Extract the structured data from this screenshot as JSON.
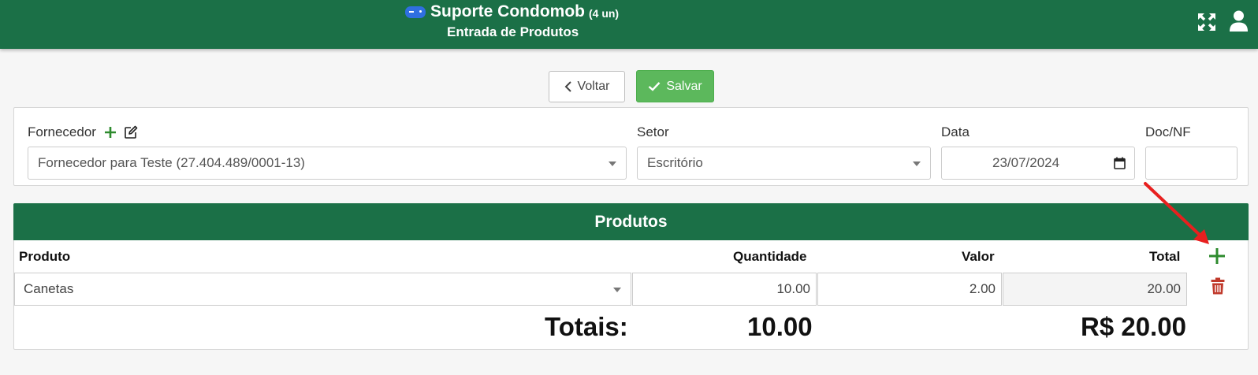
{
  "header": {
    "app_title": "Suporte Condomob",
    "units": "(4 un)",
    "subtitle": "Entrada de Produtos",
    "icons": [
      "gamepad-icon",
      "expand-icon",
      "user-icon"
    ]
  },
  "toolbar": {
    "back_label": "Voltar",
    "save_label": "Salvar"
  },
  "form": {
    "supplier_label": "Fornecedor",
    "supplier_value": "Fornecedor para Teste (27.404.489/0001-13)",
    "sector_label": "Setor",
    "sector_value": "Escritório",
    "date_label": "Data",
    "date_value": "23/07/2024",
    "doc_label": "Doc/NF",
    "doc_value": ""
  },
  "products": {
    "title": "Produtos",
    "columns": [
      "Produto",
      "Quantidade",
      "Valor",
      "Total"
    ],
    "rows": [
      {
        "product": "Canetas",
        "quantity": "10.00",
        "value": "2.00",
        "total": "20.00"
      }
    ],
    "totals_label": "Totais:",
    "totals_quantity": "10.00",
    "totals_value": "R$ 20.00"
  },
  "colors": {
    "header_green": "#1b7047",
    "save_green": "#5cb85c",
    "add_green": "#2e8b2e",
    "delete_red": "#c0392b",
    "arrow_red": "#e8201f"
  }
}
